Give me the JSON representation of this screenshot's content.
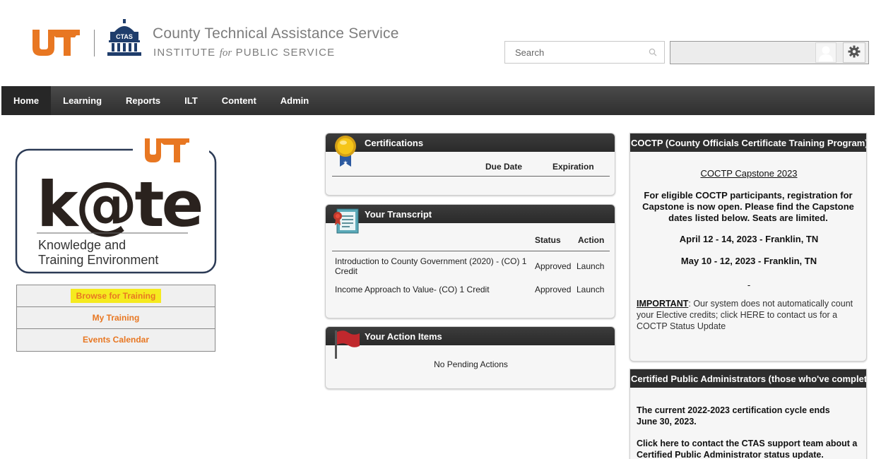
{
  "header": {
    "org_name": "County Technical Assistance Service",
    "org_sub_1": "INSTITUTE",
    "org_sub_for": "for",
    "org_sub_2": "PUBLIC SERVICE",
    "ctas_badge": "CTAS",
    "search_placeholder": "Search"
  },
  "nav": {
    "items": [
      "Home",
      "Learning",
      "Reports",
      "ILT",
      "Content",
      "Admin"
    ],
    "active": "Home"
  },
  "kate": {
    "logo_word": "k@te",
    "tagline_1": "Knowledge and",
    "tagline_2": "Training Environment"
  },
  "left_menu": {
    "items": [
      "Browse for Training",
      "My Training",
      "Events Calendar"
    ]
  },
  "certifications": {
    "title": "Certifications",
    "columns": [
      "Due Date",
      "Expiration"
    ]
  },
  "transcript": {
    "title": "Your Transcript",
    "columns": [
      "Status",
      "Action"
    ],
    "rows": [
      {
        "course": "Introduction to County Government (2020) - (CO) 1 Credit",
        "status": "Approved",
        "action": "Launch"
      },
      {
        "course": "Income Approach to Value- (CO) 1 Credit",
        "status": "Approved",
        "action": "Launch"
      }
    ]
  },
  "action_items": {
    "title": "Your Action Items",
    "empty_text": "No Pending Actions"
  },
  "coctp": {
    "title": "COCTP (County Officials Certificate Training Program)",
    "capstone_link": "COCTP Capstone 2023",
    "intro": "For eligible COCTP participants, registration for Capstone is now open. Please find the Capstone dates listed below. Seats are limited.",
    "date_1": "April 12 - 14, 2023 - Franklin, TN",
    "date_2": "May 10 - 12, 2023 - Franklin, TN",
    "dash": "-",
    "important_label": "IMPORTANT",
    "important_text": ": Our system does not automatically count your Elective credits; click HERE to contact us for a COCTP Status Update"
  },
  "cpa": {
    "title": "Certified Public Administrators (those who've completed",
    "cycle_text": "The current 2022-2023 certification cycle ends June 30, 2023.",
    "contact_text": "Click here to contact the CTAS support team about a Certified Public Administrator status update."
  },
  "colors": {
    "ut_orange": "#e87722",
    "ctas_blue": "#1f3d6b",
    "nav_dark": "#333333",
    "highlight": "#f5ea1f"
  }
}
